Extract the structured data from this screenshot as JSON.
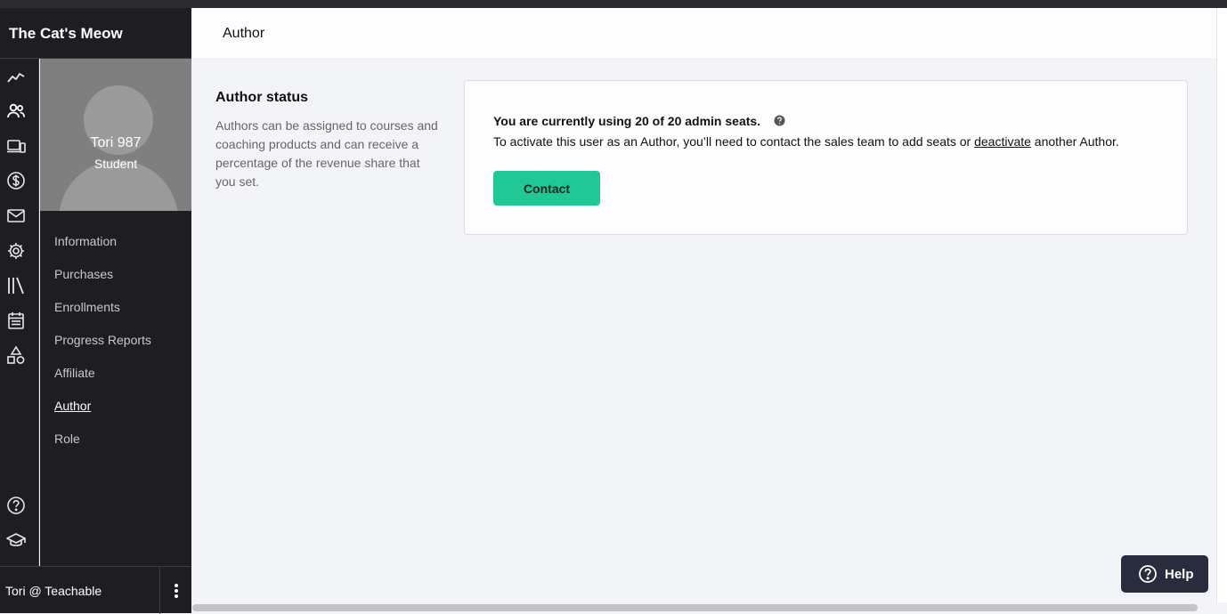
{
  "app": {
    "brand": "The Cat's Meow"
  },
  "rail": {
    "icons": [
      "trend-icon",
      "users-icon",
      "devices-icon",
      "dollar-icon",
      "mail-icon",
      "gear-icon",
      "library-icon",
      "calendar-icon",
      "shapes-icon",
      "help-circle-icon",
      "graduation-cap-icon"
    ]
  },
  "profile": {
    "name": "Tori 987",
    "role": "Student"
  },
  "subnav": {
    "items": [
      {
        "label": "Information"
      },
      {
        "label": "Purchases"
      },
      {
        "label": "Enrollments"
      },
      {
        "label": "Progress Reports"
      },
      {
        "label": "Affiliate"
      },
      {
        "label": "Author",
        "active": true
      },
      {
        "label": "Role"
      }
    ]
  },
  "user": {
    "label": "Tori @ Teachable"
  },
  "header": {
    "title": "Author"
  },
  "section": {
    "title": "Author status",
    "description": "Authors can be assigned to courses and coaching products and can receive a percentage of the revenue share that you set."
  },
  "card": {
    "seats_text": "You are currently using 20 of 20 admin seats.",
    "instruction_before": "To activate this user as an Author, you’ll need to contact the sales team to add seats or ",
    "deactivate_link": "deactivate",
    "instruction_after": " another Author.",
    "contact_button": "Contact"
  },
  "help": {
    "label": "Help"
  },
  "colors": {
    "accent": "#22c796",
    "sidebar": "#1e1e22",
    "help_bg": "#282c3c"
  }
}
